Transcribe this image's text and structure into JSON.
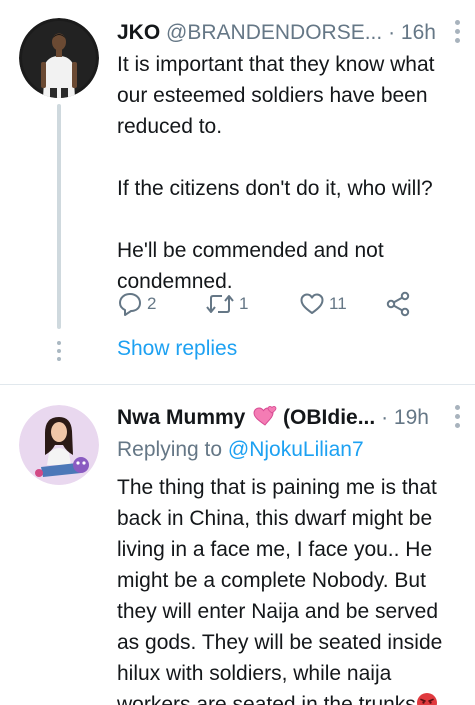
{
  "tweet1": {
    "name": "JKO",
    "handle": "@BRANDENDORSE...",
    "dot": "·",
    "time": "16h",
    "body": [
      "It is important that they know what",
      "our esteemed soldiers have been",
      "reduced to.",
      "",
      "If the citizens don't do it, who will?",
      "",
      "He'll be commended and not",
      "condemned."
    ],
    "reply_count": "2",
    "retweet_count": "1",
    "like_count": "11",
    "show_replies": "Show replies"
  },
  "tweet2": {
    "name": "Nwa Mummy",
    "name_suffix": "(OBIdie...",
    "dot": "·",
    "time": "19h",
    "replying_prefix": "Replying to",
    "replying_to": "@NjokuLilian7",
    "body": [
      "The thing that is paining me is that",
      "back in China, this dwarf might be",
      "living in a face me, I face you.. He",
      "might be a complete Nobody. But",
      "they will enter Naija and be served",
      "as gods. They will be seated inside",
      "hilux with soldiers, while naija",
      "workers are seated in the trunks"
    ]
  },
  "colors": {
    "link": "#1da1f2",
    "muted": "#657786",
    "text": "#14171a",
    "thread_line": "#cfd9de",
    "divider": "#e1e8ed"
  },
  "icons": {
    "name_emoji": "two-hearts",
    "body_emoji": "angry-face"
  }
}
